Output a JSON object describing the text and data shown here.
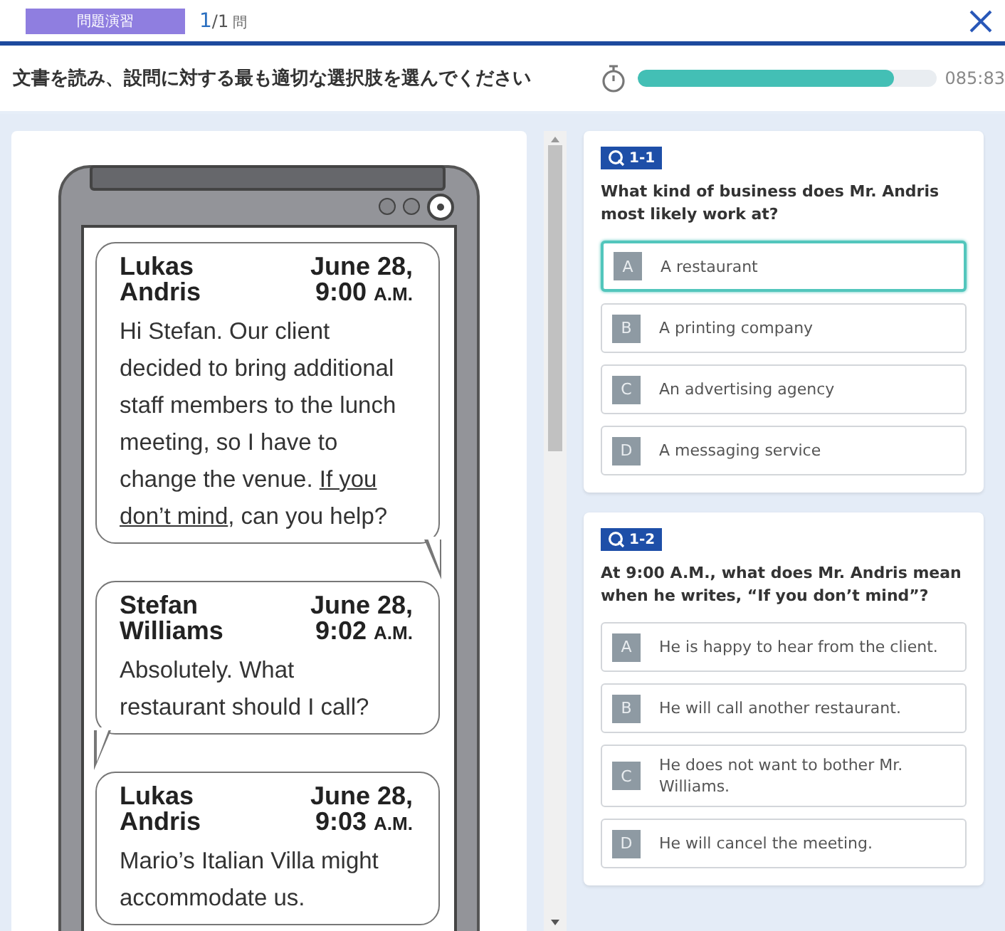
{
  "header": {
    "badge": "問題演習",
    "progress": {
      "current": "1",
      "total": "/1",
      "unit": "問"
    }
  },
  "instruction": {
    "text": "文書を読み、設問に対する最も適切な選択肢を選んでください",
    "timer": {
      "level": 0.86,
      "reading": "085:83"
    }
  },
  "messages": [
    {
      "sender": "Lukas Andris",
      "date": "June 28,",
      "time": "9:00",
      "meridiem": "A.M.",
      "tail_on_right": true,
      "segments": [
        {
          "text": "Hi Stefan. Our client decided to bring additional staff members to the lunch meeting, so I have to change the venue. ",
          "underlined": false
        },
        {
          "text": "If you don’t mind",
          "underlined": true
        },
        {
          "text": ", can you help?",
          "underlined": false
        }
      ]
    },
    {
      "sender": "Stefan Williams",
      "date": "June 28,",
      "time": "9:02",
      "meridiem": "A.M.",
      "tail_on_right": false,
      "segments": [
        {
          "text": "Absolutely. What restaurant should I call?",
          "underlined": false
        }
      ]
    },
    {
      "sender": "Lukas Andris",
      "date": "June 28,",
      "time": "9:03",
      "meridiem": "A.M.",
      "segments": [
        {
          "text": "Mario’s Italian Villa might accommodate us.",
          "underlined": false
        }
      ]
    }
  ],
  "questions": [
    {
      "number": "1-1",
      "text": "What kind of business does Mr. Andris most likely work at?",
      "choices": [
        {
          "letter": "A",
          "text": "A restaurant",
          "selected": true
        },
        {
          "letter": "B",
          "text": "A printing company",
          "selected": false
        },
        {
          "letter": "C",
          "text": "An advertising agency",
          "selected": false
        },
        {
          "letter": "D",
          "text": "A messaging service",
          "selected": false
        }
      ]
    },
    {
      "number": "1-2",
      "text": "At 9:00 A.M., what does Mr. Andris mean when he writes, “If you don’t mind”?",
      "choices": [
        {
          "letter": "A",
          "text": "He is happy to hear from the client.",
          "selected": false
        },
        {
          "letter": "B",
          "text": "He will call another restaurant.",
          "selected": false
        },
        {
          "letter": "C",
          "text": "He does not want to bother Mr. Williams.",
          "selected": false
        },
        {
          "letter": "D",
          "text": "He will cancel the meeting.",
          "selected": false
        }
      ]
    }
  ]
}
